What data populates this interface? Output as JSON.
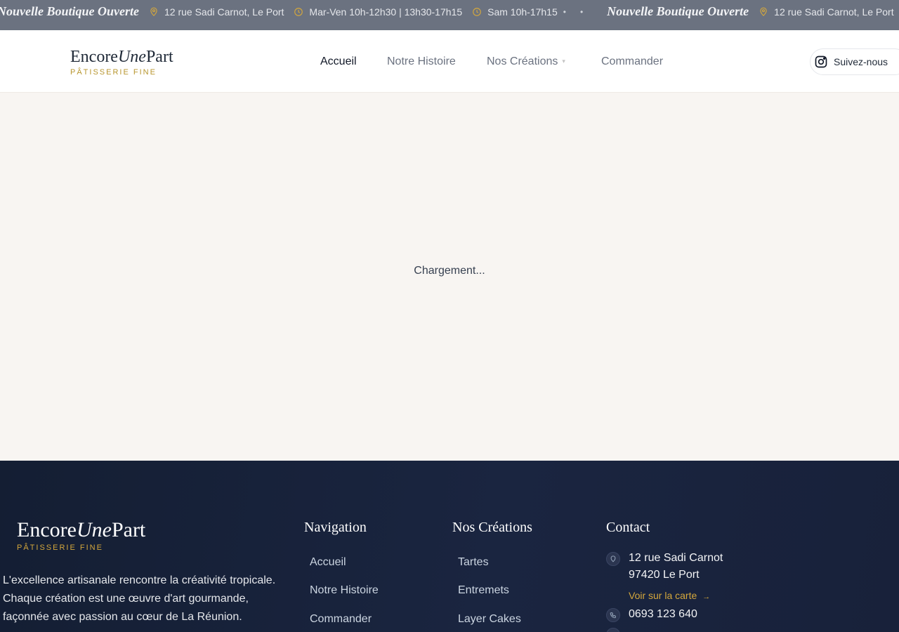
{
  "banner": {
    "title": "Nouvelle Boutique Ouverte",
    "address": "12 rue Sadi Carnot, Le Port",
    "hours_week": "Mar-Ven 10h-12h30 | 13h30-17h15",
    "hours_saturday": "Sam 10h-17h15",
    "separator": "•"
  },
  "brand": {
    "name_start": "Encore",
    "name_italic": "Une",
    "name_end": "Part",
    "tagline": "PÂTISSERIE FINE"
  },
  "nav": {
    "home": "Accueil",
    "story": "Notre Histoire",
    "creations": "Nos Créations",
    "order": "Commander"
  },
  "social": {
    "follow_label": "Suivez-nous"
  },
  "main": {
    "loading_text": "Chargement..."
  },
  "footer": {
    "description": "L'excellence artisanale rencontre la créativité tropicale. Chaque création est une œuvre d'art gourmande, façonnée avec passion au cœur de La Réunion.",
    "navigation": {
      "title": "Navigation",
      "links": [
        "Accueil",
        "Notre Histoire",
        "Commander"
      ]
    },
    "creations": {
      "title": "Nos Créations",
      "links": [
        "Tartes",
        "Entremets",
        "Layer Cakes"
      ]
    },
    "contact": {
      "title": "Contact",
      "address_line1": "12 rue Sadi Carnot",
      "address_line2": "97420 Le Port",
      "map_link": "Voir sur la carte",
      "phone": "0693 123 640"
    }
  },
  "colors": {
    "banner_bg": "#6b7280",
    "accent_gold": "#b8962e",
    "footer_bg": "#141e33",
    "page_bg": "#f8f5f2"
  }
}
